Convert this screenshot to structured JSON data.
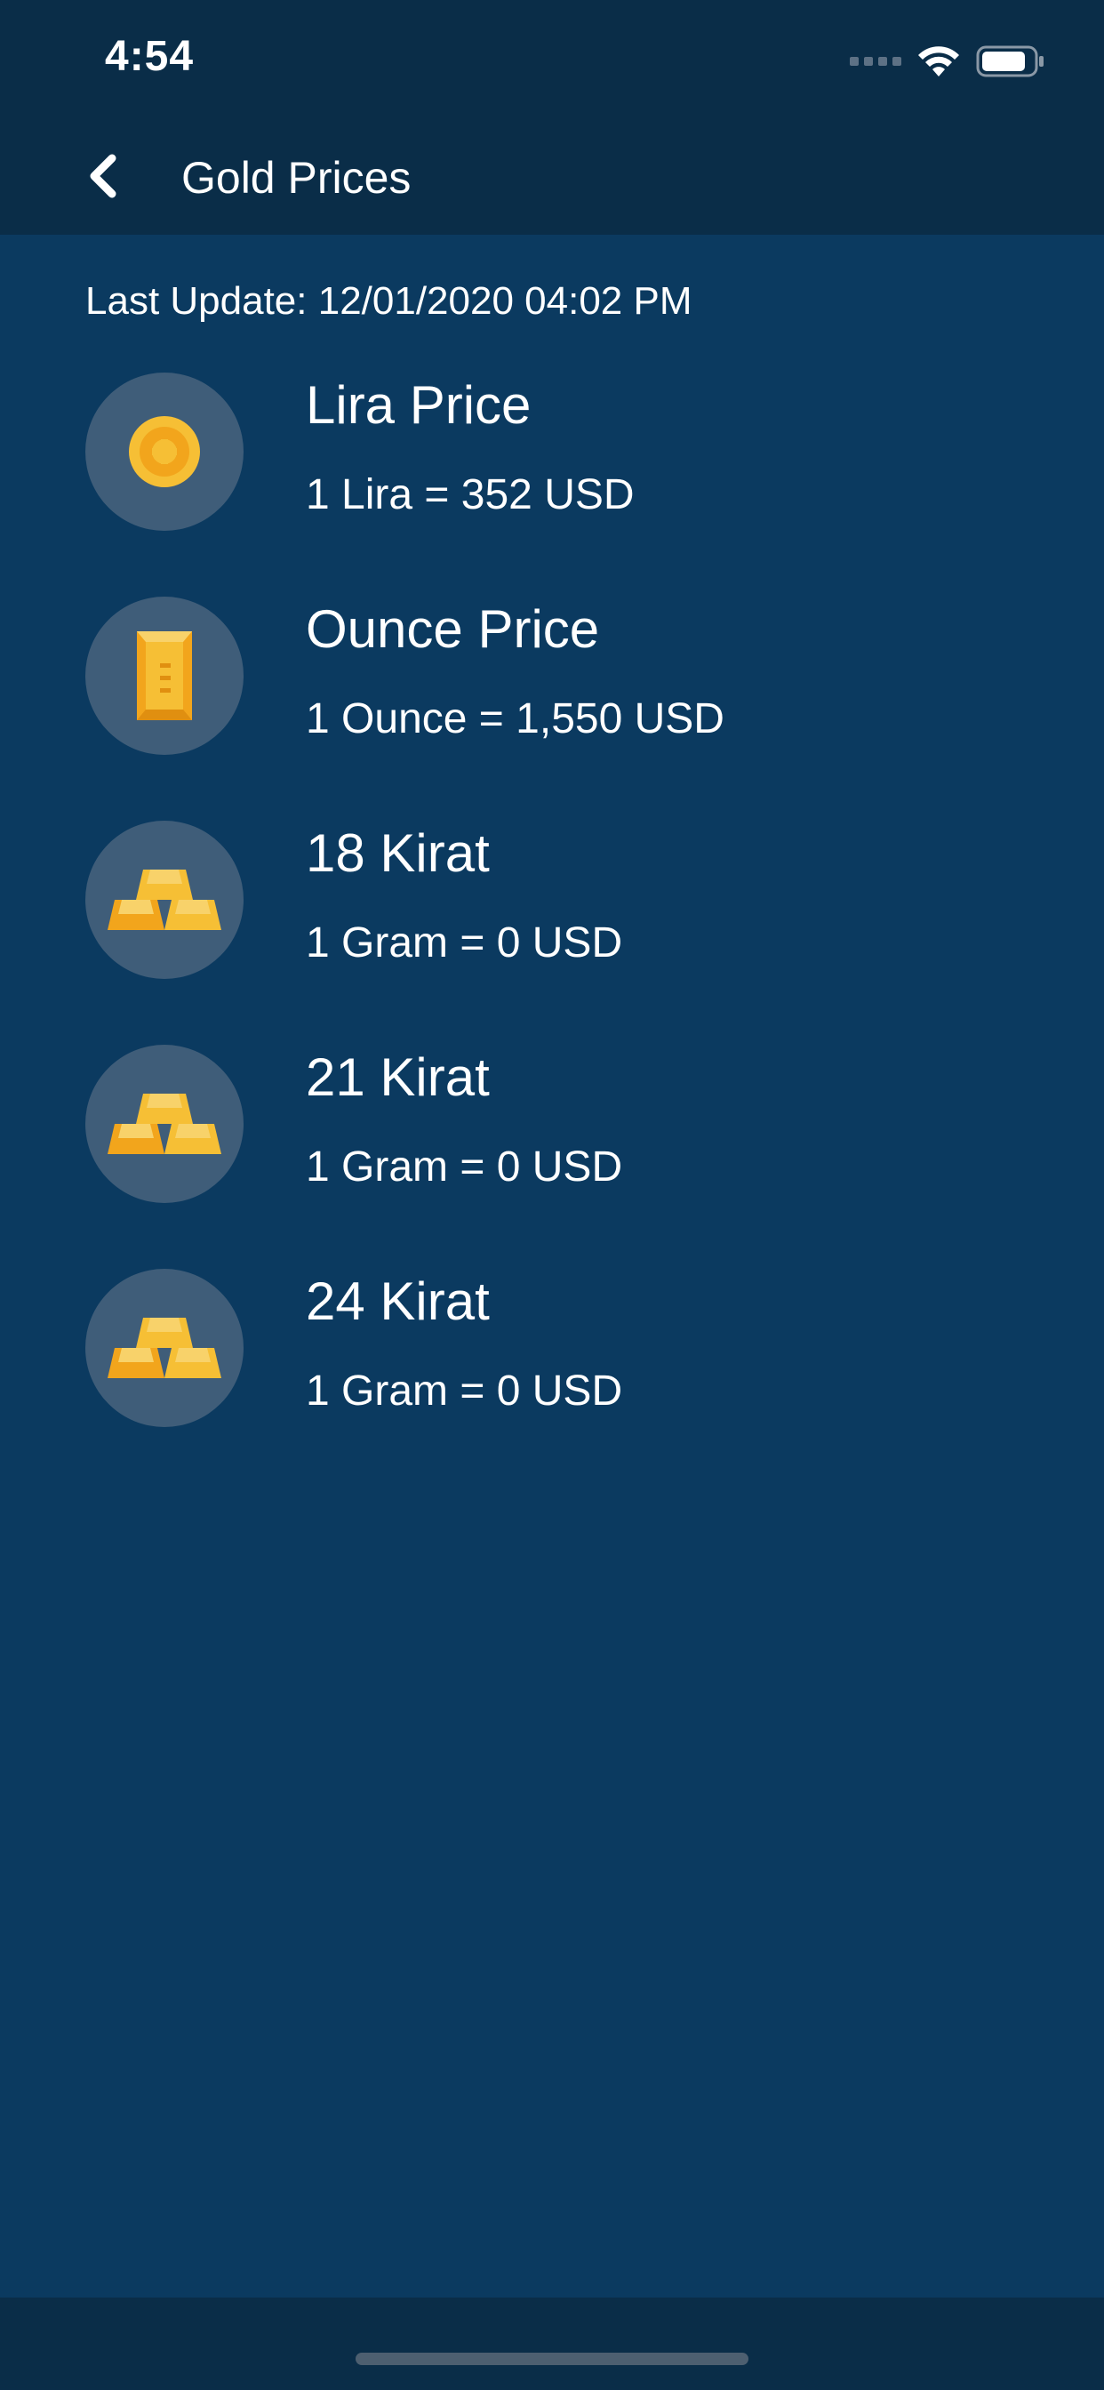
{
  "status_bar": {
    "time": "4:54"
  },
  "app_bar": {
    "title": "Gold Prices"
  },
  "last_update": "Last Update: 12/01/2020 04:02 PM",
  "items": [
    {
      "title": "Lira Price",
      "value": "1 Lira = 352 USD",
      "icon": "gold-coin-icon"
    },
    {
      "title": "Ounce Price",
      "value": "1 Ounce = 1,550 USD",
      "icon": "gold-bar-icon"
    },
    {
      "title": "18 Kirat",
      "value": "1 Gram = 0 USD",
      "icon": "gold-bars-stack-icon"
    },
    {
      "title": "21 Kirat",
      "value": "1 Gram = 0 USD",
      "icon": "gold-bars-stack-icon"
    },
    {
      "title": "24 Kirat",
      "value": "1 Gram = 0 USD",
      "icon": "gold-bars-stack-icon"
    }
  ],
  "colors": {
    "background": "#0b3a60",
    "app_bar": "#0a2d48",
    "icon_circle": "#3f5d79",
    "gold": "#f6bf35"
  }
}
